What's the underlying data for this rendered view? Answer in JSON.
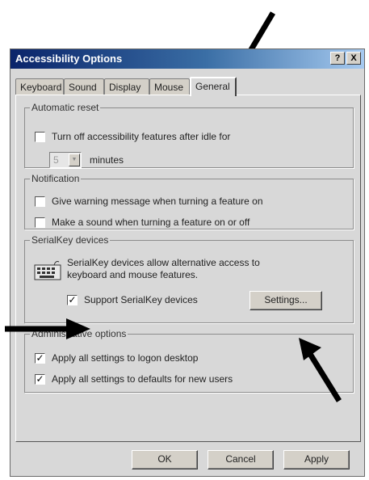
{
  "window": {
    "title": "Accessibility Options",
    "help_btn": "?",
    "close_btn": "X"
  },
  "tabs": [
    {
      "label": "Keyboard",
      "active": false
    },
    {
      "label": "Sound",
      "active": false
    },
    {
      "label": "Display",
      "active": false
    },
    {
      "label": "Mouse",
      "active": false
    },
    {
      "label": "General",
      "active": true
    }
  ],
  "automatic_reset": {
    "legend": "Automatic reset",
    "turn_off_label": "Turn off accessibility features after idle for",
    "turn_off_checked": false,
    "minutes_value": "5",
    "minutes_label": "minutes"
  },
  "notification": {
    "legend": "Notification",
    "items": [
      {
        "label": "Give warning message when turning a feature on",
        "checked": false
      },
      {
        "label": "Make a sound when turning a feature on or off",
        "checked": false
      }
    ]
  },
  "serialkey": {
    "legend": "SerialKey devices",
    "description": "SerialKey devices allow alternative access to keyboard and mouse features.",
    "support_label": "Support SerialKey devices",
    "support_checked": true,
    "settings_button": "Settings..."
  },
  "admin": {
    "legend": "Administrative options",
    "items": [
      {
        "label": "Apply all settings to logon desktop",
        "checked": true
      },
      {
        "label": "Apply all settings to defaults for new users",
        "checked": true
      }
    ]
  },
  "footer": {
    "ok": "OK",
    "cancel": "Cancel",
    "apply": "Apply"
  },
  "check_glyph": "✓"
}
